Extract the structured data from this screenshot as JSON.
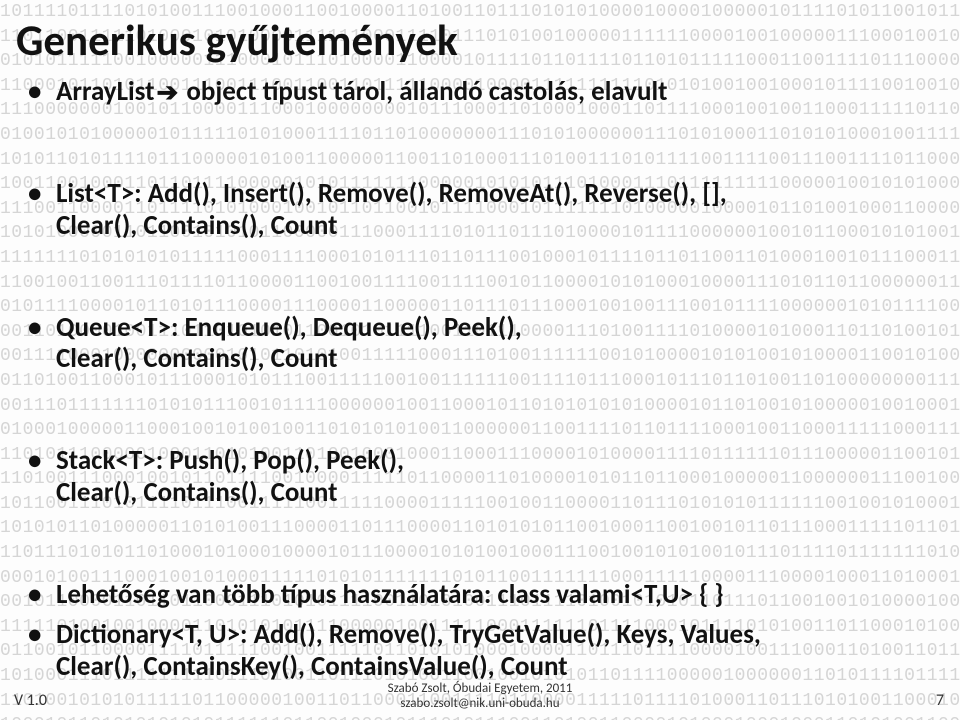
{
  "title": "Generikus gyűjtemények",
  "bullets": {
    "b0": "ArrayList",
    "b0_after": " object típust tárol, állandó castolás, elavult",
    "b1_l1": "List<T>: Add(), Insert(), Remove(), RemoveAt(), Reverse(), [],",
    "b1_l2": "Clear(), Contains(), Count",
    "b2_l1": "Queue<T>: Enqueue(), Dequeue(), Peek(),",
    "b2_l2": "Clear(), Contains(), Count",
    "b3_l1": "Stack<T>: Push(), Pop(), Peek(),",
    "b3_l2": "Clear(), Contains(), Count",
    "b4": "Lehetőség van több típus használatára: class valami<T,U> { }",
    "b5_l1": "Dictionary<T, U>: Add(), Remove(), TryGetValue(), Keys, Values,",
    "b5_l2": "Clear(), ContainsKey(), ContainsValue(), Count"
  },
  "footer": {
    "version": "V 1.0",
    "credit_line1": "Szabó Zsolt, Óbudai Egyetem, 2011",
    "credit_line2": "szabo.zsolt@nik.uni-obuda.hu",
    "page": "7"
  },
  "arrow_glyph": "➔"
}
